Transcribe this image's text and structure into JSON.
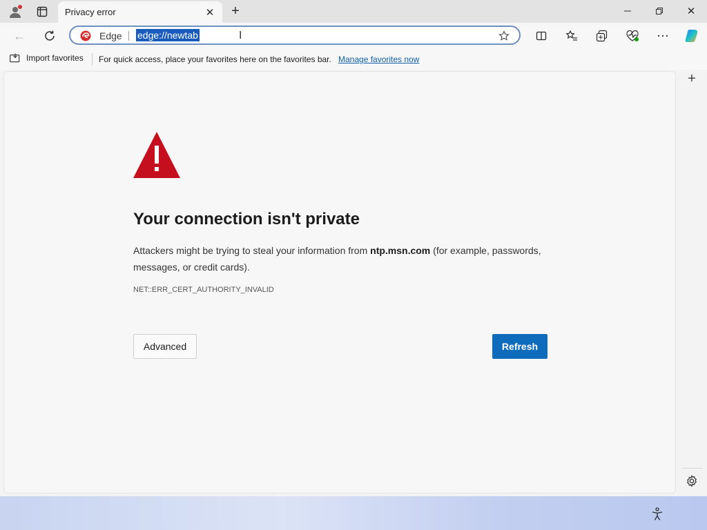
{
  "tab": {
    "title": "Privacy error",
    "close_icon": "close-icon"
  },
  "toolbar": {
    "omnibox_site_label": "Edge",
    "url": "edge://newtab"
  },
  "favorites_bar": {
    "import_label": "Import favorites",
    "hint": "For quick access, place your favorites here on the favorites bar.",
    "manage_link": "Manage favorites now"
  },
  "error_page": {
    "heading": "Your connection isn't private",
    "desc_before": "Attackers might be trying to steal your information from ",
    "desc_host": "ntp.msn.com",
    "desc_after": " (for example, passwords, messages, or credit cards).",
    "error_code": "NET::ERR_CERT_AUTHORITY_INVALID",
    "advanced_label": "Advanced",
    "refresh_label": "Refresh"
  },
  "colors": {
    "accent": "#0f6cbd",
    "warning": "#c50f1f",
    "link": "#0f5ea8"
  }
}
